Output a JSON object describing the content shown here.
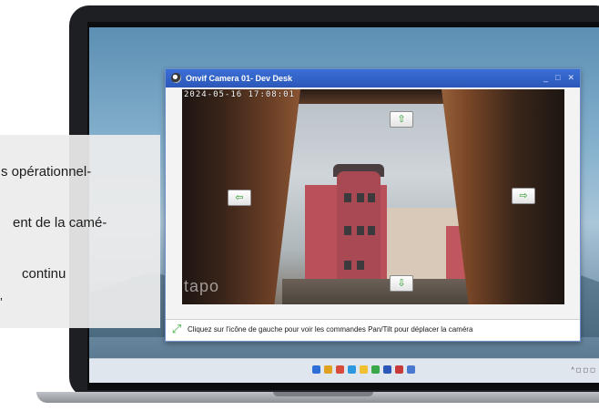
{
  "window": {
    "title": "Onvif Camera 01- Dev Desk",
    "controls": [
      "_",
      "□",
      "✕"
    ]
  },
  "video": {
    "timestamp": "2024-05-16 17:08:01",
    "watermark": "tapo",
    "ptz": {
      "up_icon": "arrow-up-icon",
      "down_icon": "arrow-down-icon",
      "left_icon": "arrow-left-icon",
      "right_icon": "arrow-right-icon",
      "up_glyph": "⇧",
      "down_glyph": "⇩",
      "left_glyph": "⇦",
      "right_glyph": "⇨"
    }
  },
  "statusbar": {
    "icon": "expand-arrows-icon",
    "text": "Cliquez sur l'icône de gauche pour voir les commandes Pan/Tilt pour déplacer la caméra"
  },
  "overlay_card": {
    "lines": [
      "s opérationnel-",
      "ent de la camé-",
      "continu",
      "’"
    ]
  },
  "taskbar": {
    "tray": "^ ◻ ◻ ◻"
  },
  "colors": {
    "title_bar": "#2b57b8",
    "ptz_arrow": "#2a9a2a",
    "building": "#b9505a"
  }
}
